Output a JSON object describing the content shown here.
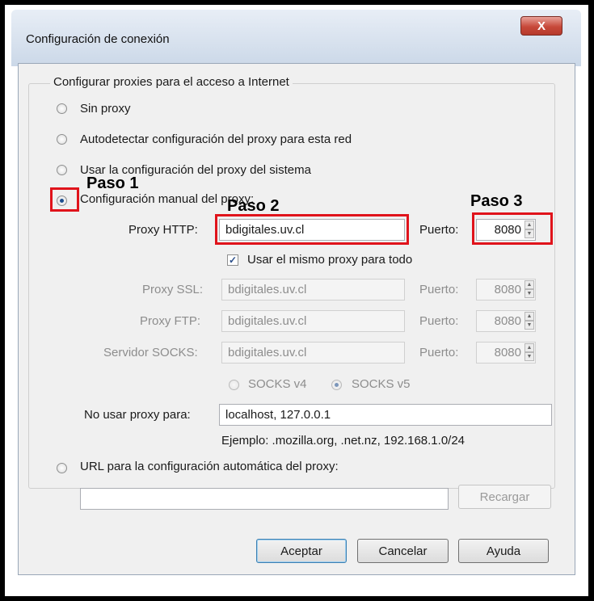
{
  "window": {
    "title": "Configuración de conexión",
    "close_label": "X"
  },
  "group_label": "Configurar proxies para el acceso a Internet",
  "options": {
    "no_proxy": "Sin proxy",
    "auto_detect": "Autodetectar configuración del proxy para esta red",
    "system": "Usar la configuración del proxy del sistema",
    "manual": "Configuración manual del proxy:",
    "auto_url": "URL para la configuración automática del proxy:"
  },
  "manual": {
    "http_label": "Proxy HTTP:",
    "http_value": "bdigitales.uv.cl",
    "port_label": "Puerto:",
    "http_port": "8080",
    "same_proxy_label": "Usar el mismo proxy para todo",
    "same_proxy_checked": true,
    "ssl_label": "Proxy SSL:",
    "ssl_value": "bdigitales.uv.cl",
    "ssl_port": "8080",
    "ftp_label": "Proxy FTP:",
    "ftp_value": "bdigitales.uv.cl",
    "ftp_port": "8080",
    "socks_label": "Servidor SOCKS:",
    "socks_value": "bdigitales.uv.cl",
    "socks_port": "8080",
    "socks_v4": "SOCKS v4",
    "socks_v5": "SOCKS v5",
    "no_proxy_label": "No usar proxy para:",
    "no_proxy_value": "localhost, 127.0.0.1",
    "example": "Ejemplo: .mozilla.org, .net.nz, 192.168.1.0/24"
  },
  "auto_url_value": "",
  "buttons": {
    "reload": "Recargar",
    "ok": "Aceptar",
    "cancel": "Cancelar",
    "help": "Ayuda"
  },
  "annotations": {
    "step1": "Paso 1",
    "step2": "Paso 2",
    "step3": "Paso 3",
    "color": "#e0131b"
  }
}
